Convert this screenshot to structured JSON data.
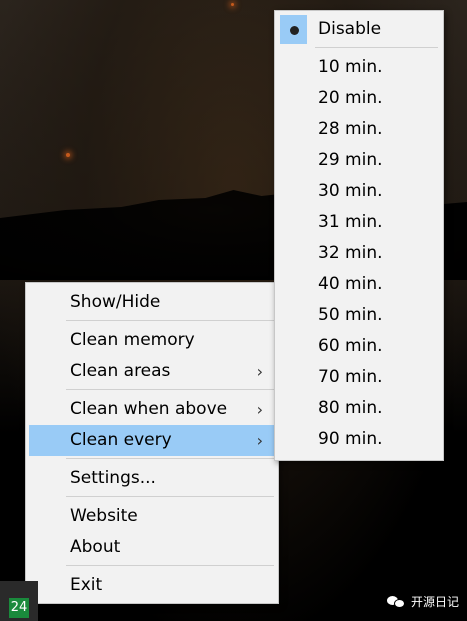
{
  "main_menu": {
    "show_hide": "Show/Hide",
    "clean_memory": "Clean memory",
    "clean_areas": "Clean areas",
    "clean_when_above": "Clean when above",
    "clean_every": "Clean every",
    "settings": "Settings...",
    "website": "Website",
    "about": "About",
    "exit": "Exit",
    "submenu_arrow": "›"
  },
  "submenu": {
    "selected": "Disable",
    "items": [
      "Disable",
      "10 min.",
      "20 min.",
      "28 min.",
      "29 min.",
      "30 min.",
      "31 min.",
      "32 min.",
      "40 min.",
      "50 min.",
      "60 min.",
      "70 min.",
      "80 min.",
      "90 min."
    ]
  },
  "tray": {
    "icon_label": "24"
  },
  "watermark": {
    "text": "开源日记"
  },
  "colors": {
    "highlight": "#99cbf6",
    "menu_bg": "#f2f2f2",
    "tray_icon": "#1a8a3c"
  }
}
